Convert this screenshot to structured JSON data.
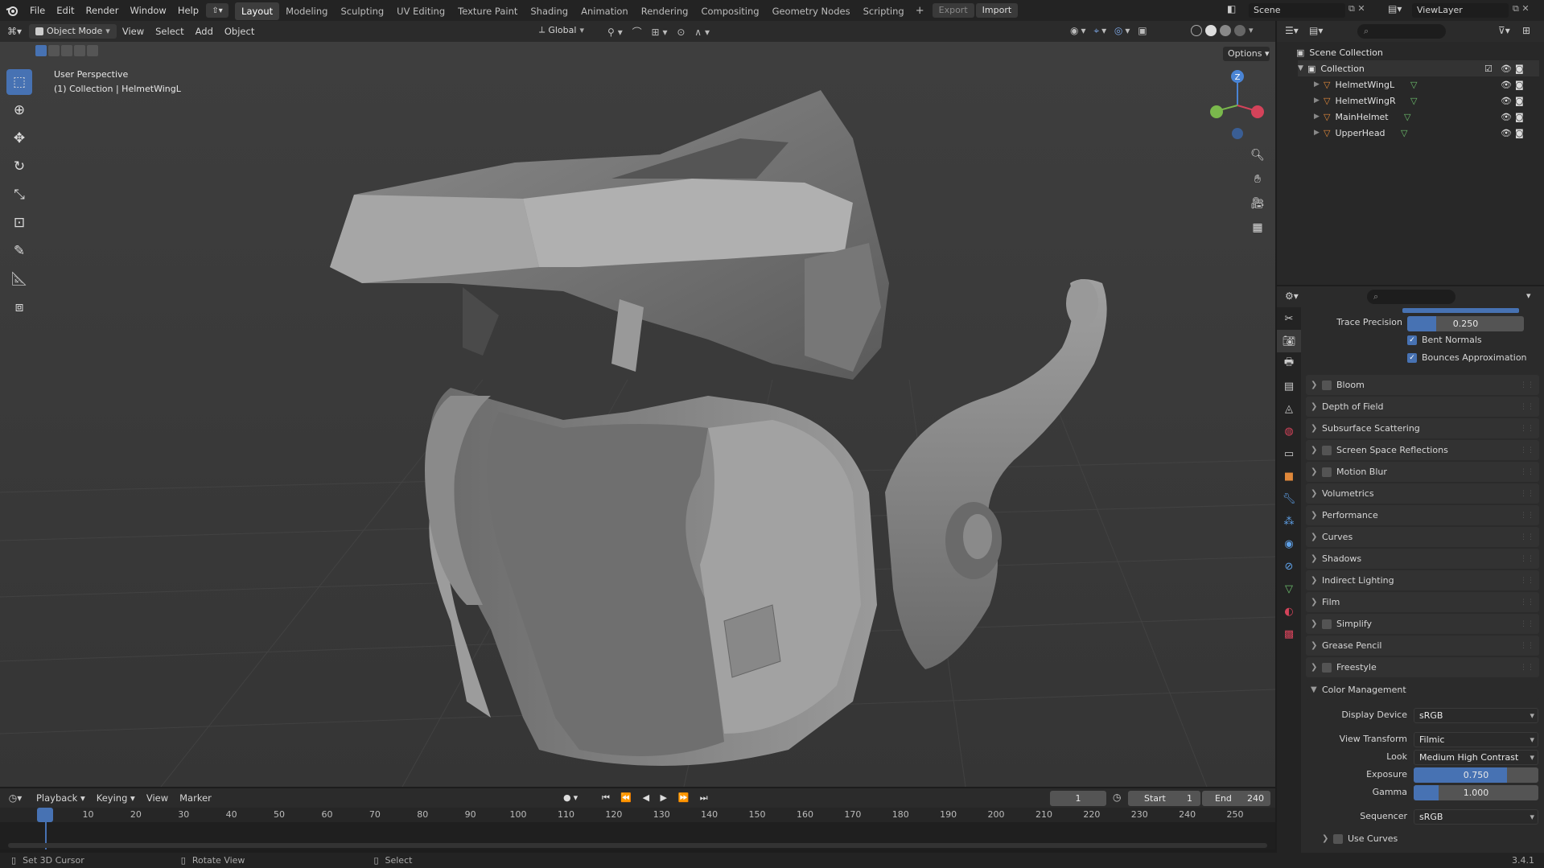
{
  "topbar": {
    "menus": [
      "File",
      "Edit",
      "Render",
      "Window",
      "Help"
    ],
    "workspaces": [
      "Layout",
      "Modeling",
      "Sculpting",
      "UV Editing",
      "Texture Paint",
      "Shading",
      "Animation",
      "Rendering",
      "Compositing",
      "Geometry Nodes",
      "Scripting"
    ],
    "active_workspace": "Layout",
    "export_label": "Export",
    "import_label": "Import",
    "scene_name": "Scene",
    "view_layer": "ViewLayer"
  },
  "viewport_header": {
    "mode": "Object Mode",
    "menus": [
      "View",
      "Select",
      "Add",
      "Object"
    ],
    "transform_orientation": "Global",
    "options_label": "Options"
  },
  "viewport": {
    "perspective_label": "User Perspective",
    "context_label": "(1) Collection | HelmetWingL",
    "gizmo_z": "Z"
  },
  "outliner": {
    "scene_collection": "Scene Collection",
    "collection": "Collection",
    "objects": [
      "HelmetWingL",
      "HelmetWingR",
      "MainHelmet",
      "UpperHead"
    ]
  },
  "properties": {
    "trace_precision_label": "Trace Precision",
    "trace_precision_value": "0.250",
    "trace_precision_fill": 0.25,
    "bent_normals_label": "Bent Normals",
    "bounces_label": "Bounces Approximation",
    "panels": [
      {
        "label": "Bloom",
        "checkbox": true
      },
      {
        "label": "Depth of Field",
        "checkbox": false
      },
      {
        "label": "Subsurface Scattering",
        "checkbox": false
      },
      {
        "label": "Screen Space Reflections",
        "checkbox": true
      },
      {
        "label": "Motion Blur",
        "checkbox": true
      },
      {
        "label": "Volumetrics",
        "checkbox": false
      },
      {
        "label": "Performance",
        "checkbox": false
      },
      {
        "label": "Curves",
        "checkbox": false
      },
      {
        "label": "Shadows",
        "checkbox": false
      },
      {
        "label": "Indirect Lighting",
        "checkbox": false
      },
      {
        "label": "Film",
        "checkbox": false
      },
      {
        "label": "Simplify",
        "checkbox": true
      },
      {
        "label": "Grease Pencil",
        "checkbox": false
      },
      {
        "label": "Freestyle",
        "checkbox": true
      }
    ],
    "color_management_label": "Color Management",
    "display_device_label": "Display Device",
    "display_device_value": "sRGB",
    "view_transform_label": "View Transform",
    "view_transform_value": "Filmic",
    "look_label": "Look",
    "look_value": "Medium High Contrast",
    "exposure_label": "Exposure",
    "exposure_value": "0.750",
    "exposure_fill": 0.75,
    "gamma_label": "Gamma",
    "gamma_value": "1.000",
    "gamma_fill": 0.2,
    "sequencer_label": "Sequencer",
    "sequencer_value": "sRGB",
    "use_curves_label": "Use Curves"
  },
  "timeline": {
    "menus": [
      "Playback",
      "Keying",
      "View",
      "Marker"
    ],
    "current_frame": "1",
    "start_label": "Start",
    "start_value": "1",
    "end_label": "End",
    "end_value": "240",
    "ticks": [
      "1",
      "10",
      "20",
      "30",
      "40",
      "50",
      "60",
      "70",
      "80",
      "90",
      "100",
      "110",
      "120",
      "130",
      "140",
      "150",
      "160",
      "170",
      "180",
      "190",
      "200",
      "210",
      "220",
      "230",
      "240",
      "250"
    ]
  },
  "statusbar": {
    "hint1": "Set 3D Cursor",
    "hint2": "Rotate View",
    "hint3": "Select",
    "version": "3.4.1"
  },
  "colors": {
    "accent": "#4772b3",
    "header": "#2b2b2b",
    "viewport": "#3c3c3c",
    "orange_icon": "#e0883a",
    "green_icon": "#6dbf6d"
  }
}
